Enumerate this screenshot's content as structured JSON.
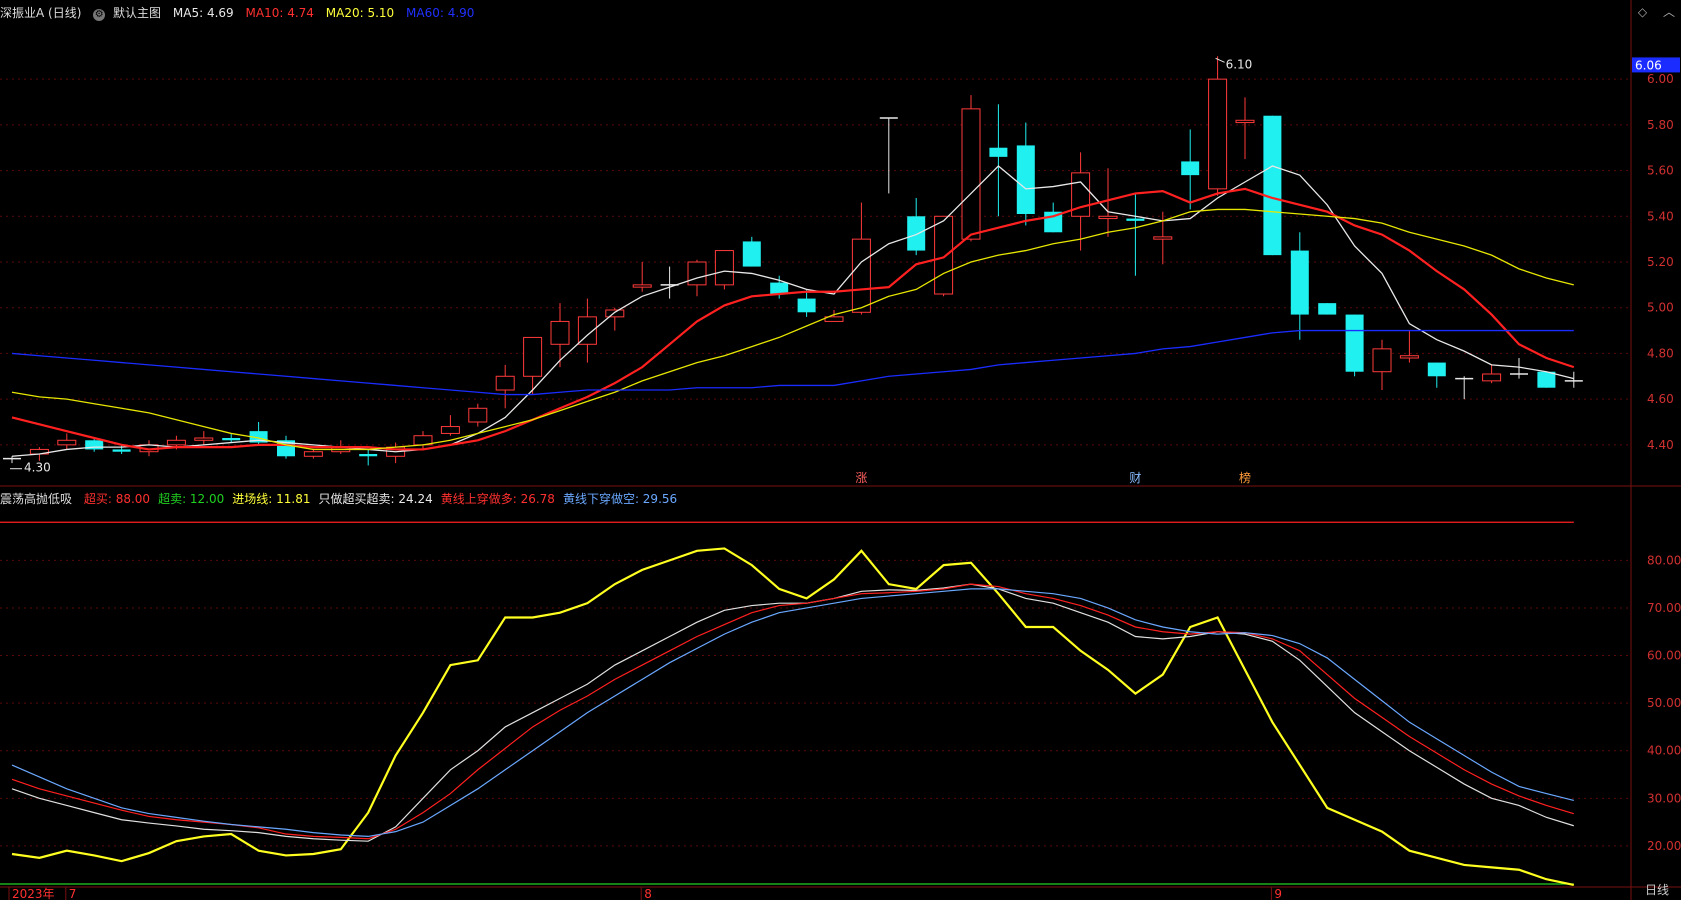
{
  "top_bar": {
    "symbol": "深振业A (日线)",
    "template_label": "默认主图",
    "ma5": {
      "label": "MA5:",
      "value": "4.69",
      "color": "#e8e8e8"
    },
    "ma10": {
      "label": "MA10:",
      "value": "4.74",
      "color": "#ff3030"
    },
    "ma20": {
      "label": "MA20:",
      "value": "5.10",
      "color": "#ffff3a"
    },
    "ma60": {
      "label": "MA60:",
      "value": "4.90",
      "color": "#2030ff"
    }
  },
  "corner_icons": [
    "diamond-icon",
    "chevron-up-icon"
  ],
  "indicator_bar": {
    "name": "震荡高抛低吸",
    "items": [
      {
        "label": "超买:",
        "value": "88.00",
        "color": "#ff3030"
      },
      {
        "label": "超卖:",
        "value": "12.00",
        "color": "#20d020"
      },
      {
        "label": "进场线:",
        "value": "11.81",
        "color": "#ffff3a"
      },
      {
        "label": "只做超买超卖:",
        "value": "24.24",
        "color": "#e8e8e8"
      },
      {
        "label": "黄线上穿做多:",
        "value": "26.78",
        "color": "#ff3030"
      },
      {
        "label": "黄线下穿做空:",
        "value": "29.56",
        "color": "#6aa8ff"
      }
    ]
  },
  "bottom_label": "日线",
  "chart_data": [
    {
      "type": "candlestick",
      "price_badge": "6.06",
      "high_label": "6.10",
      "low_label": "4.30",
      "ylim": [
        4.22,
        6.25
      ],
      "y_ticks": [
        "6.00",
        "5.80",
        "5.60",
        "5.40",
        "5.20",
        "5.00",
        "4.80",
        "4.60",
        "4.40"
      ],
      "x_labels": [
        {
          "index": 0,
          "text": "2023年",
          "color": "#ff3030"
        },
        {
          "index": 2,
          "text": "7",
          "color": "#ff3030"
        },
        {
          "index": 23,
          "text": "8",
          "color": "#ff3030"
        },
        {
          "index": 46,
          "text": "9",
          "color": "#ff3030"
        }
      ],
      "event_tags": [
        {
          "index": 31,
          "text": "涨",
          "color": "#ff6060"
        },
        {
          "index": 41,
          "text": "财",
          "color": "#88bbff"
        },
        {
          "index": 45,
          "text": "榜",
          "color": "#ff9a3a"
        }
      ],
      "ohlc": [
        [
          4.34,
          4.35,
          4.32,
          4.34
        ],
        [
          4.36,
          4.39,
          4.33,
          4.38
        ],
        [
          4.4,
          4.45,
          4.38,
          4.42
        ],
        [
          4.42,
          4.43,
          4.37,
          4.38
        ],
        [
          4.38,
          4.4,
          4.36,
          4.37
        ],
        [
          4.37,
          4.42,
          4.35,
          4.4
        ],
        [
          4.4,
          4.44,
          4.38,
          4.42
        ],
        [
          4.42,
          4.46,
          4.4,
          4.43
        ],
        [
          4.43,
          4.45,
          4.41,
          4.42
        ],
        [
          4.46,
          4.5,
          4.4,
          4.41
        ],
        [
          4.42,
          4.44,
          4.34,
          4.35
        ],
        [
          4.35,
          4.38,
          4.34,
          4.37
        ],
        [
          4.37,
          4.42,
          4.36,
          4.39
        ],
        [
          4.36,
          4.38,
          4.31,
          4.35
        ],
        [
          4.35,
          4.41,
          4.32,
          4.39
        ],
        [
          4.4,
          4.46,
          4.38,
          4.44
        ],
        [
          4.45,
          4.53,
          4.44,
          4.48
        ],
        [
          4.5,
          4.58,
          4.48,
          4.56
        ],
        [
          4.64,
          4.75,
          4.56,
          4.7
        ],
        [
          4.7,
          4.86,
          4.62,
          4.87
        ],
        [
          4.84,
          5.02,
          4.74,
          4.94
        ],
        [
          4.84,
          5.04,
          4.76,
          4.96
        ],
        [
          4.96,
          5.0,
          4.9,
          4.99
        ],
        [
          5.09,
          5.2,
          5.07,
          5.1
        ],
        [
          5.1,
          5.18,
          5.04,
          5.1
        ],
        [
          5.1,
          5.21,
          5.05,
          5.2
        ],
        [
          5.1,
          5.25,
          5.08,
          5.25
        ],
        [
          5.29,
          5.31,
          5.18,
          5.18
        ],
        [
          5.11,
          5.14,
          5.04,
          5.06
        ],
        [
          5.04,
          5.08,
          4.96,
          4.98
        ],
        [
          4.94,
          4.99,
          4.94,
          4.96
        ],
        [
          4.98,
          5.46,
          4.97,
          5.3
        ],
        [
          5.83,
          5.83,
          5.5,
          5.83
        ],
        [
          5.4,
          5.48,
          5.23,
          5.25
        ],
        [
          5.06,
          5.4,
          5.05,
          5.4
        ],
        [
          5.3,
          5.93,
          5.29,
          5.87
        ],
        [
          5.7,
          5.89,
          5.4,
          5.66
        ],
        [
          5.71,
          5.81,
          5.36,
          5.41
        ],
        [
          5.42,
          5.46,
          5.33,
          5.33
        ],
        [
          5.4,
          5.68,
          5.25,
          5.59
        ],
        [
          5.39,
          5.61,
          5.31,
          5.4
        ],
        [
          5.39,
          5.5,
          5.14,
          5.38
        ],
        [
          5.3,
          5.42,
          5.19,
          5.31
        ],
        [
          5.64,
          5.78,
          5.43,
          5.58
        ],
        [
          5.52,
          6.1,
          5.49,
          6.0
        ],
        [
          5.81,
          5.92,
          5.65,
          5.82
        ],
        [
          5.84,
          5.84,
          5.23,
          5.23
        ],
        [
          5.25,
          5.33,
          4.86,
          4.97
        ],
        [
          5.02,
          5.02,
          4.97,
          4.97
        ],
        [
          4.97,
          4.97,
          4.7,
          4.72
        ],
        [
          4.72,
          4.86,
          4.64,
          4.82
        ],
        [
          4.78,
          4.9,
          4.76,
          4.79
        ],
        [
          4.76,
          4.76,
          4.65,
          4.7
        ],
        [
          4.69,
          4.7,
          4.6,
          4.69
        ],
        [
          4.68,
          4.75,
          4.67,
          4.71
        ],
        [
          4.71,
          4.78,
          4.69,
          4.71
        ],
        [
          4.72,
          4.72,
          4.65,
          4.65
        ],
        [
          4.68,
          4.72,
          4.65,
          4.68
        ]
      ],
      "series": [
        {
          "name": "MA5",
          "color": "#e8e8e8",
          "values": [
            4.35,
            4.36,
            4.38,
            4.39,
            4.39,
            4.4,
            4.39,
            4.4,
            4.41,
            4.42,
            4.41,
            4.4,
            4.39,
            4.38,
            4.37,
            4.38,
            4.4,
            4.45,
            4.52,
            4.64,
            4.77,
            4.88,
            4.98,
            5.05,
            5.09,
            5.13,
            5.16,
            5.15,
            5.12,
            5.08,
            5.06,
            5.2,
            5.28,
            5.32,
            5.38,
            5.5,
            5.62,
            5.52,
            5.53,
            5.55,
            5.42,
            5.4,
            5.38,
            5.39,
            5.48,
            5.55,
            5.62,
            5.58,
            5.45,
            5.27,
            5.15,
            4.93,
            4.86,
            4.81,
            4.75,
            4.74,
            4.72,
            4.69
          ]
        },
        {
          "name": "MA10",
          "color": "#ff2020",
          "values": [
            4.52,
            4.49,
            4.46,
            4.43,
            4.4,
            4.38,
            4.39,
            4.39,
            4.39,
            4.4,
            4.4,
            4.39,
            4.39,
            4.39,
            4.38,
            4.38,
            4.4,
            4.42,
            4.46,
            4.51,
            4.56,
            4.61,
            4.67,
            4.74,
            4.84,
            4.94,
            5.01,
            5.05,
            5.06,
            5.07,
            5.07,
            5.08,
            5.09,
            5.19,
            5.22,
            5.32,
            5.35,
            5.38,
            5.4,
            5.44,
            5.47,
            5.5,
            5.51,
            5.46,
            5.5,
            5.52,
            5.48,
            5.45,
            5.42,
            5.36,
            5.32,
            5.25,
            5.16,
            5.08,
            4.97,
            4.84,
            4.78,
            4.74
          ]
        },
        {
          "name": "MA20",
          "color": "#e6e600",
          "values": [
            4.63,
            4.61,
            4.6,
            4.58,
            4.56,
            4.54,
            4.51,
            4.48,
            4.45,
            4.43,
            4.4,
            4.38,
            4.38,
            4.38,
            4.39,
            4.4,
            4.42,
            4.45,
            4.48,
            4.51,
            4.55,
            4.59,
            4.63,
            4.68,
            4.72,
            4.76,
            4.79,
            4.83,
            4.87,
            4.92,
            4.97,
            5.0,
            5.05,
            5.08,
            5.15,
            5.2,
            5.23,
            5.25,
            5.28,
            5.3,
            5.33,
            5.35,
            5.38,
            5.42,
            5.43,
            5.43,
            5.42,
            5.41,
            5.4,
            5.39,
            5.37,
            5.33,
            5.3,
            5.27,
            5.23,
            5.17,
            5.13,
            5.1
          ]
        },
        {
          "name": "MA60",
          "color": "#1a2cff",
          "values": [
            4.8,
            4.79,
            4.78,
            4.77,
            4.76,
            4.75,
            4.74,
            4.73,
            4.72,
            4.71,
            4.7,
            4.69,
            4.68,
            4.67,
            4.66,
            4.65,
            4.64,
            4.63,
            4.62,
            4.62,
            4.63,
            4.64,
            4.64,
            4.64,
            4.64,
            4.65,
            4.65,
            4.65,
            4.66,
            4.66,
            4.66,
            4.68,
            4.7,
            4.71,
            4.72,
            4.73,
            4.75,
            4.76,
            4.77,
            4.78,
            4.79,
            4.8,
            4.82,
            4.83,
            4.85,
            4.87,
            4.89,
            4.9,
            4.9,
            4.9,
            4.9,
            4.9,
            4.9,
            4.9,
            4.9,
            4.9,
            4.9,
            4.9
          ]
        }
      ]
    },
    {
      "type": "line",
      "ylim": [
        12,
        91
      ],
      "y_ticks": [
        "80.00",
        "70.00",
        "60.00",
        "50.00",
        "40.00",
        "30.00",
        "20.00"
      ],
      "reference_lines": [
        {
          "value": 88,
          "color": "#ff2020"
        },
        {
          "value": 12,
          "color": "#20d020"
        }
      ],
      "series": [
        {
          "name": "进场线",
          "color": "#ffff20",
          "values": [
            18.3,
            17.5,
            19,
            18,
            16.8,
            18.5,
            21,
            22,
            22.5,
            19,
            18,
            18.3,
            19.3,
            27,
            39,
            48,
            58,
            59,
            68,
            68,
            69,
            71,
            75,
            78,
            80,
            82,
            82.5,
            79,
            74,
            72,
            76,
            82,
            75,
            74,
            79,
            79.5,
            73,
            66,
            66,
            61,
            57,
            52,
            56,
            66,
            68,
            57,
            46,
            37,
            28,
            25.5,
            23,
            19,
            17.5,
            16,
            15.5,
            15,
            13,
            11.81
          ]
        },
        {
          "name": "只做超买超卖",
          "color": "#e0e0e0",
          "values": [
            32,
            30,
            28.5,
            27,
            25.5,
            24.8,
            24.2,
            23.5,
            23.2,
            22.8,
            22,
            21.5,
            21.2,
            21,
            24,
            30,
            36,
            40,
            45,
            48,
            51,
            54,
            58,
            61,
            64,
            67,
            69.5,
            70.5,
            71,
            71,
            72,
            73.5,
            73.8,
            73.7,
            74.2,
            75,
            74,
            72,
            71,
            69,
            67,
            64,
            63.5,
            64,
            65,
            64.5,
            63,
            59,
            53.5,
            48,
            44,
            40,
            36.5,
            33,
            30,
            28.5,
            26,
            24.24
          ]
        },
        {
          "name": "黄线上穿做多",
          "color": "#ff2020",
          "values": [
            34,
            32,
            30.5,
            29,
            27.5,
            26.2,
            25.5,
            25,
            24.5,
            23.8,
            22.5,
            22,
            21.8,
            21.5,
            23.5,
            27,
            31,
            36,
            40.5,
            45,
            48.5,
            51.5,
            55,
            58,
            61,
            64,
            66.5,
            69,
            70.5,
            71,
            72,
            73,
            73.2,
            73.5,
            74,
            75,
            74.5,
            73,
            72,
            70.5,
            68.5,
            66,
            65,
            64.5,
            65,
            64.8,
            63.5,
            61,
            56,
            51,
            47,
            43,
            39.5,
            36,
            33,
            30.5,
            28.5,
            26.78
          ]
        },
        {
          "name": "黄线下穿做空",
          "color": "#6aa8ff",
          "values": [
            37,
            34.5,
            32,
            30,
            28,
            26.8,
            26,
            25.2,
            24.5,
            24,
            23.5,
            22.8,
            22.3,
            22,
            23,
            25,
            28.5,
            32,
            36,
            40,
            44,
            48,
            51.5,
            55,
            58.5,
            61.5,
            64.5,
            67,
            69,
            70,
            71,
            72,
            72.5,
            73,
            73.5,
            74,
            74,
            73.5,
            73,
            72,
            70,
            67.5,
            66,
            65,
            64.5,
            64.8,
            64.2,
            62.5,
            59.5,
            55,
            50.5,
            46,
            42.5,
            39,
            35.5,
            32.5,
            31,
            29.56
          ]
        }
      ]
    }
  ]
}
